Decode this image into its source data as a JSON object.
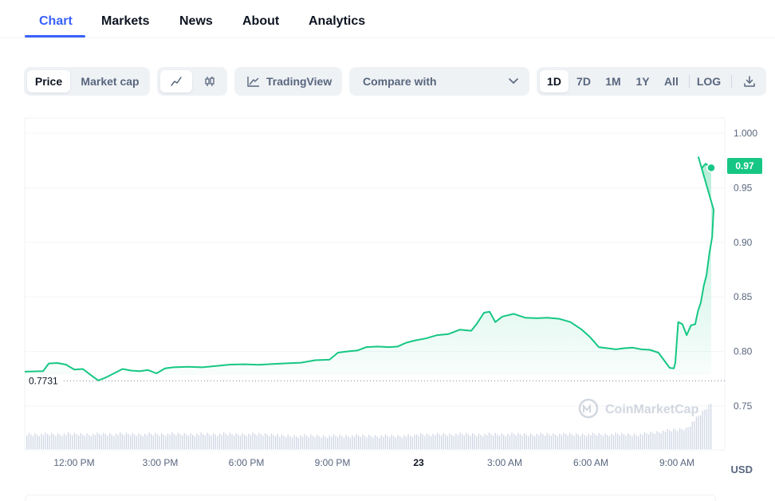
{
  "tabs": [
    {
      "label": "Chart",
      "active": true
    },
    {
      "label": "Markets",
      "active": false
    },
    {
      "label": "News",
      "active": false
    },
    {
      "label": "About",
      "active": false
    },
    {
      "label": "Analytics",
      "active": false
    }
  ],
  "toolbar": {
    "metric_options": [
      "Price",
      "Market cap"
    ],
    "metric_selected": "Price",
    "chart_styles": [
      "line-chart-icon",
      "candlestick-icon"
    ],
    "tradingview_label": "TradingView",
    "compare_label": "Compare with",
    "ranges": [
      "1D",
      "7D",
      "1M",
      "1Y",
      "All"
    ],
    "range_selected": "1D",
    "log_label": "LOG",
    "download_icon": "download-icon"
  },
  "colors": {
    "accent": "#3861fb",
    "line": "#16c784",
    "muted": "#58667e"
  },
  "chart_data": {
    "type": "line",
    "x_ticks": [
      "12:00 PM",
      "3:00 PM",
      "6:00 PM",
      "9:00 PM",
      "23",
      "3:00 AM",
      "6:00 AM",
      "9:00 AM"
    ],
    "y_ticks": [
      "1.000",
      "0.95",
      "0.90",
      "0.85",
      "0.80",
      "0.75"
    ],
    "ylim": [
      0.72,
      1.0
    ],
    "x_range_hours": [
      10.25,
      34.55
    ],
    "currency_label": "USD",
    "reference_value": 0.7731,
    "reference_label": "0.7731",
    "current_value": 0.97,
    "current_label": "0.97",
    "watermark": "CoinMarketCap",
    "series": [
      {
        "points": [
          [
            10.25,
            0.7815
          ],
          [
            10.9,
            0.782
          ],
          [
            11.1,
            0.789
          ],
          [
            11.4,
            0.7895
          ],
          [
            11.7,
            0.788
          ],
          [
            12.0,
            0.7835
          ],
          [
            12.3,
            0.784
          ],
          [
            12.6,
            0.778
          ],
          [
            12.85,
            0.7735
          ],
          [
            13.1,
            0.776
          ],
          [
            13.4,
            0.78
          ],
          [
            13.7,
            0.784
          ],
          [
            14.0,
            0.7825
          ],
          [
            14.3,
            0.782
          ],
          [
            14.6,
            0.783
          ],
          [
            14.9,
            0.78
          ],
          [
            15.2,
            0.7845
          ],
          [
            15.5,
            0.7855
          ],
          [
            16.0,
            0.786
          ],
          [
            16.5,
            0.7855
          ],
          [
            17.0,
            0.7868
          ],
          [
            17.5,
            0.788
          ],
          [
            18.0,
            0.7883
          ],
          [
            18.5,
            0.7878
          ],
          [
            19.0,
            0.7885
          ],
          [
            19.5,
            0.7892
          ],
          [
            20.0,
            0.7898
          ],
          [
            20.5,
            0.792
          ],
          [
            21.0,
            0.7925
          ],
          [
            21.3,
            0.799
          ],
          [
            21.6,
            0.8
          ],
          [
            22.0,
            0.801
          ],
          [
            22.3,
            0.804
          ],
          [
            22.7,
            0.8045
          ],
          [
            23.1,
            0.804
          ],
          [
            23.4,
            0.8045
          ],
          [
            23.7,
            0.808
          ],
          [
            24.0,
            0.81
          ],
          [
            24.4,
            0.812
          ],
          [
            24.8,
            0.815
          ],
          [
            25.2,
            0.816
          ],
          [
            25.6,
            0.82
          ],
          [
            26.0,
            0.819
          ],
          [
            26.2,
            0.8255
          ],
          [
            26.45,
            0.8355
          ],
          [
            26.65,
            0.8365
          ],
          [
            26.85,
            0.827
          ],
          [
            27.1,
            0.832
          ],
          [
            27.5,
            0.8345
          ],
          [
            27.9,
            0.831
          ],
          [
            28.3,
            0.8305
          ],
          [
            28.7,
            0.831
          ],
          [
            29.1,
            0.83
          ],
          [
            29.5,
            0.827
          ],
          [
            29.9,
            0.82
          ],
          [
            30.2,
            0.813
          ],
          [
            30.5,
            0.804
          ],
          [
            30.8,
            0.803
          ],
          [
            31.1,
            0.802
          ],
          [
            31.4,
            0.803
          ],
          [
            31.7,
            0.8035
          ],
          [
            32.0,
            0.802
          ],
          [
            32.3,
            0.8015
          ],
          [
            32.6,
            0.799
          ],
          [
            32.8,
            0.792
          ],
          [
            33.0,
            0.785
          ],
          [
            33.15,
            0.7845
          ],
          [
            33.2,
            0.79
          ],
          [
            33.3,
            0.827
          ],
          [
            33.45,
            0.825
          ],
          [
            33.6,
            0.815
          ],
          [
            33.75,
            0.824
          ],
          [
            33.9,
            0.825
          ],
          [
            34.0,
            0.837
          ],
          [
            34.1,
            0.845
          ],
          [
            34.2,
            0.86
          ],
          [
            34.3,
            0.87
          ],
          [
            34.4,
            0.89
          ],
          [
            34.5,
            0.905
          ],
          [
            34.55,
            0.93
          ]
        ]
      }
    ]
  }
}
